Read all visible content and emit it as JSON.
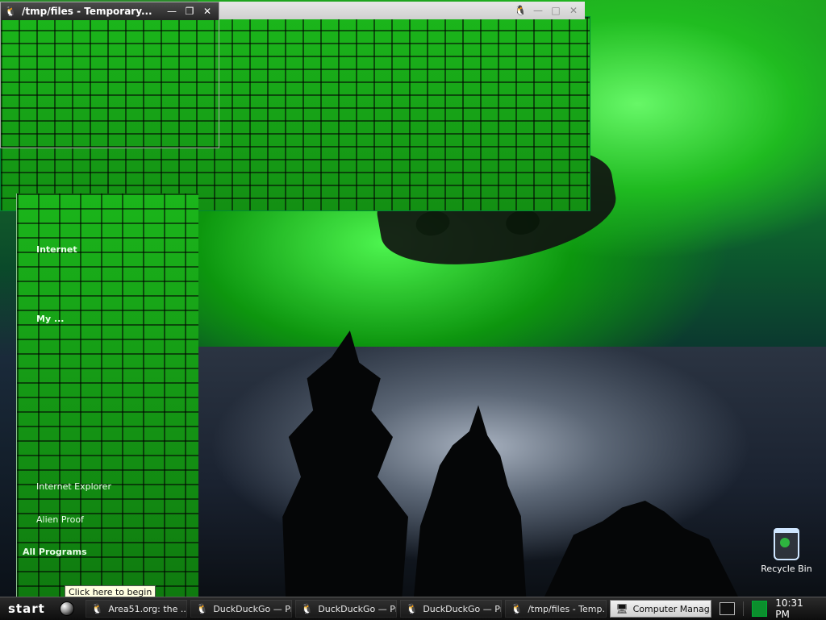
{
  "windows": {
    "front": {
      "title": "/tmp/files - Temporary...",
      "icon": "penguin-icon",
      "buttons": [
        "minimize",
        "maximize",
        "close"
      ]
    },
    "back": {
      "title": "",
      "icon": "penguin-icon",
      "buttons": [
        "minimize",
        "maximize",
        "close"
      ]
    }
  },
  "start_menu": {
    "items": [
      "Internet",
      "My ...",
      "Internet Explorer",
      "Alien Proof",
      "All Programs"
    ]
  },
  "tooltip": {
    "text": "Click here to begin"
  },
  "taskbar": {
    "start_label": "start",
    "tasks": [
      {
        "label": "Area51.org: the ...",
        "active": false,
        "icon": "penguin-icon"
      },
      {
        "label": "DuckDuckGo — Pr...",
        "active": false,
        "icon": "penguin-icon"
      },
      {
        "label": "DuckDuckGo — Pr...",
        "active": false,
        "icon": "penguin-icon"
      },
      {
        "label": "DuckDuckGo — Pr...",
        "active": false,
        "icon": "penguin-icon"
      },
      {
        "label": "/tmp/files - Temp...",
        "active": false,
        "icon": "penguin-icon"
      },
      {
        "label": "Computer Manag...",
        "active": true,
        "icon": "computer-icon"
      }
    ],
    "time": "10:31 PM"
  },
  "desktop": {
    "recycle_bin_label": "Recycle Bin"
  }
}
